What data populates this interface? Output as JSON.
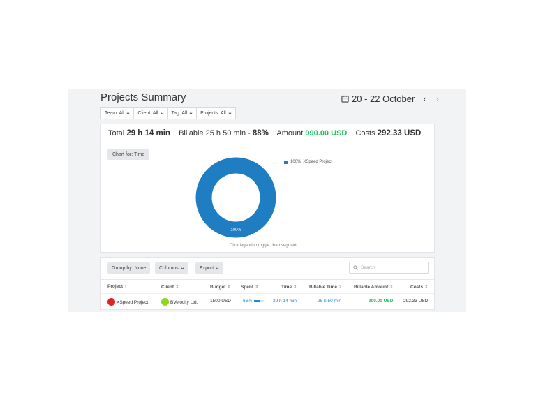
{
  "header": {
    "title": "Projects Summary",
    "date_range": "20 - 22 October",
    "prev_icon": "chevron-left-icon",
    "next_icon": "chevron-right-icon",
    "calendar_icon": "calendar-icon"
  },
  "filters": [
    {
      "label": "Team: All"
    },
    {
      "label": "Client: All"
    },
    {
      "label": "Tag: All"
    },
    {
      "label": "Projects: All"
    }
  ],
  "totals": {
    "total_label": "Total",
    "total_value": "29 h 14 min",
    "billable_label": "Billable",
    "billable_value": "25 h 50 min",
    "billable_dash": " - ",
    "billable_pct": "88%",
    "amount_label": "Amount",
    "amount_value": "990.00 USD",
    "costs_label": "Costs",
    "costs_value": "292.33 USD"
  },
  "chart": {
    "chart_for": "Chart for: Time",
    "segment_label": "100%",
    "legend": {
      "pct": "100%",
      "name": "XSpeed Project",
      "color": "#1e7ec1"
    },
    "hint": "Click legend to toggle chart segment."
  },
  "toolbar": {
    "group_by": "Group by: None",
    "columns": "Columns",
    "export": "Export",
    "search_placeholder": "Search"
  },
  "table": {
    "columns": {
      "project": "Project",
      "client": "Client",
      "budget": "Budget",
      "spent": "Spent",
      "time": "Time",
      "billable_time": "Billable Time",
      "billable_amount": "Billable Amount",
      "costs": "Costs"
    },
    "rows": [
      {
        "project": "XSpeed Project",
        "project_color": "#e02424",
        "client": "BVelocity Ltd.",
        "client_color": "#8fd61c",
        "budget": "1500 USD",
        "spent": "66%",
        "spent_fraction": 0.66,
        "time": "29 h 14 min",
        "billable_time": "25 h 50 min",
        "billable_amount": "990.00 USD",
        "costs": "292.33 USD"
      }
    ]
  },
  "colors": {
    "accent_blue": "#1e7ec1",
    "green": "#20c05c"
  }
}
